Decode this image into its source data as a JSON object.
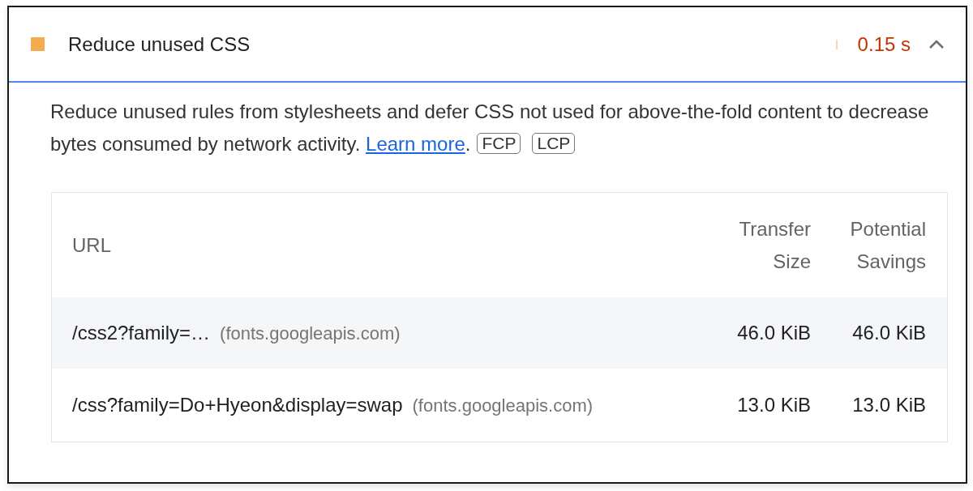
{
  "audit": {
    "title": "Reduce unused CSS",
    "kind": "average",
    "display_value": "0.15 s",
    "expanded": true
  },
  "description": {
    "text": "Reduce unused rules from stylesheets and defer CSS not used for above-the-fold content to decrease bytes consumed by network activity. ",
    "link": "Learn more",
    "after_link": ".",
    "metrics": [
      "FCP",
      "LCP"
    ]
  },
  "table": {
    "columns": [
      "URL",
      "Transfer Size",
      "Potential Savings"
    ],
    "rows": [
      {
        "url": "/css2?family=…",
        "host": "(fonts.googleapis.com)",
        "transfer_size": "46.0 KiB",
        "potential_savings": "46.0 KiB"
      },
      {
        "url": "/css?family=Do+Hyeon&display=swap",
        "host": "(fonts.googleapis.com)",
        "transfer_size": "13.0 KiB",
        "potential_savings": "13.0 KiB"
      }
    ]
  }
}
